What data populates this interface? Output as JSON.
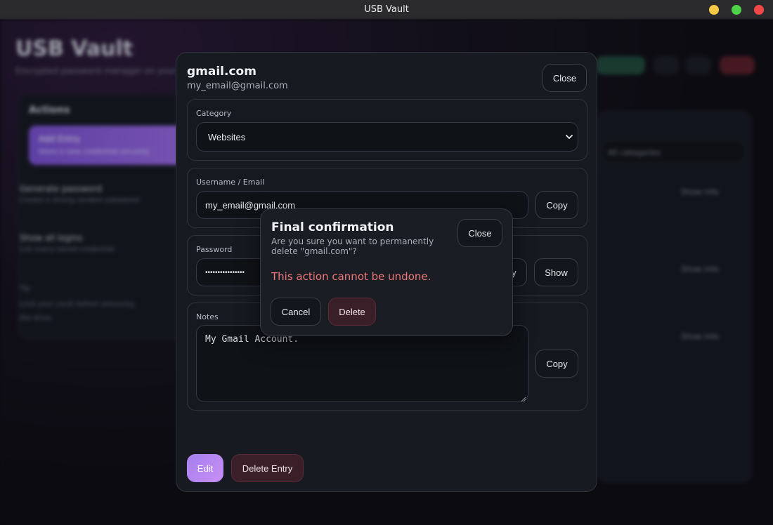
{
  "window": {
    "title": "USB Vault"
  },
  "background": {
    "app_title": "USB Vault",
    "subtitle": "Encrypted password manager on your USB drive",
    "panel_title": "Actions",
    "active_item": {
      "label": "Add Entry",
      "sub": "Store a new credential securely"
    },
    "items": [
      {
        "label": "Generate password",
        "sub": "Create a strong random password"
      },
      {
        "label": "Show all logins",
        "sub": "List every saved credential"
      }
    ],
    "notes": [
      "Tip",
      "Lock your vault before removing",
      "the drive."
    ],
    "filter_placeholder": "All categories",
    "row_action": "Show info",
    "colors": {
      "accent": "#8b5cf6",
      "danger": "#f07878",
      "success": "#34d399"
    }
  },
  "entry": {
    "title": "gmail.com",
    "username_display": "my_email@gmail.com",
    "close_label": "Close",
    "category": {
      "label": "Category",
      "selected": "Websites"
    },
    "username": {
      "label": "Username / Email",
      "value": "my_email@gmail.com",
      "copy_label": "Copy"
    },
    "password": {
      "label": "Password",
      "masked_value": "••••••••••••••••",
      "copy_label": "Copy",
      "show_label": "Show"
    },
    "notes": {
      "label": "Notes",
      "value": "My Gmail Account.",
      "copy_label": "Copy"
    },
    "edit_label": "Edit",
    "delete_label": "Delete Entry"
  },
  "confirm": {
    "title": "Final confirmation",
    "message": "Are you sure you want to permanently delete \"gmail.com\"?",
    "warning": "This action cannot be undone.",
    "close_label": "Close",
    "cancel_label": "Cancel",
    "delete_label": "Delete"
  }
}
